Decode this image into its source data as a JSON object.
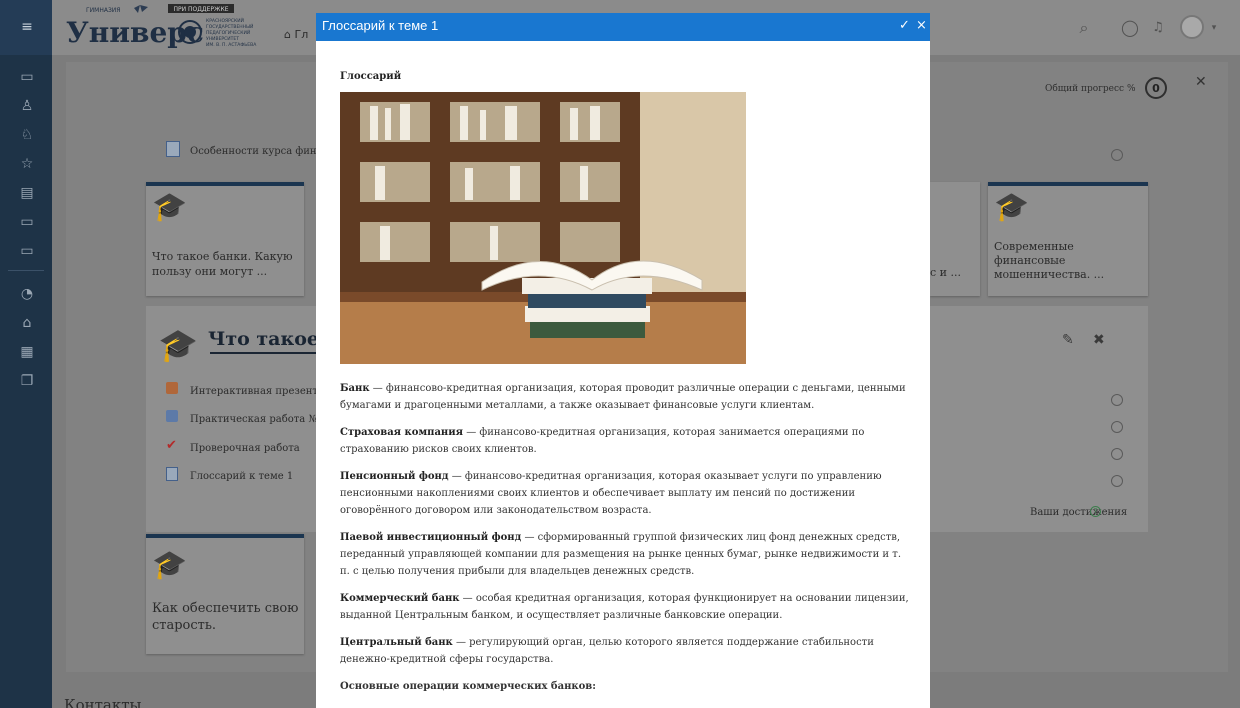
{
  "header": {
    "logo_top_left": "ГИМНАЗИЯ",
    "logo_top_right": "ПРИ ПОДДЕРЖКЕ",
    "logo_main": "Универс",
    "logo_sub": [
      "КРАСНОЯРСКИЙ",
      "ГОСУДАРСТВЕННЫЙ",
      "ПЕДАГОГИЧЕСКИЙ",
      "УНИВЕРСИТЕТ",
      "ИМ. В. П. АСТАФЬЕВА"
    ],
    "breadcrumb": "Гл",
    "progress_label": "Общий прогресс %",
    "progress_value": "0"
  },
  "background": {
    "course_intro_link": "Особенности курса финанс",
    "cards": [
      {
        "title_line1": "Что такое банки. Какую",
        "title_line2": "пользу они могут ..."
      },
      {
        "title_line1": "с и ..."
      },
      {
        "title_line1": "Современные",
        "title_line2": "финансовые",
        "title_line3": "мошенничества. ..."
      },
      {
        "title_line1": "Как обеспечить свою",
        "title_line2": "старость."
      }
    ],
    "section_title": "Что такое б",
    "activities": [
      "Интерактивная презентаци",
      "Практическая работа №1",
      "Проверочная работа",
      "Глоссарий к теме 1"
    ],
    "achievements_label": "Ваши достижения",
    "footer_heading": "Контакты"
  },
  "modal": {
    "title": "Глоссарий к теме 1",
    "heading": "Глоссарий",
    "terms": [
      {
        "term": "Банк",
        "definition": " — финансово-кредитная организация, которая проводит различные операции с деньгами, ценными бумагами и драгоценными металлами, а также оказывает финансовые услуги клиентам."
      },
      {
        "term": "Страховая компания",
        "definition": " — финансово-кредитная организация, которая занимается операциями по страхованию рисков своих клиентов."
      },
      {
        "term": "Пенсионный фонд",
        "definition": " — финансово-кредитная организация, которая оказывает услуги по управлению пенсионными накоплениями своих клиентов и обеспечивает выплату им пенсий по достижении оговорённого договором или законодательством возраста."
      },
      {
        "term": "Паевой инвестиционный фонд",
        "definition": " — сформированный группой физических лиц фонд денежных средств, переданный управляющей компании для размещения на рынке ценных бумаг, рынке недвижимости и т. п. с целью получения прибыли для владельцев денежных средств."
      },
      {
        "term": "Коммерческий банк",
        "definition": " — особая кредитная организация, которая функционирует на основании лицензии, выданной Центральным банком, и осуществляет различные банковские операции."
      },
      {
        "term": "Центральный банк",
        "definition": " — регулирующий орган, целью которого является поддержание стабильности денежно-кредитной сферы государства."
      }
    ],
    "subheading": "Основные операции коммерческих банков:"
  },
  "colors": {
    "modal_header": "#1977d0",
    "rail": "#1e3347",
    "card_accent": "#1b3550"
  }
}
